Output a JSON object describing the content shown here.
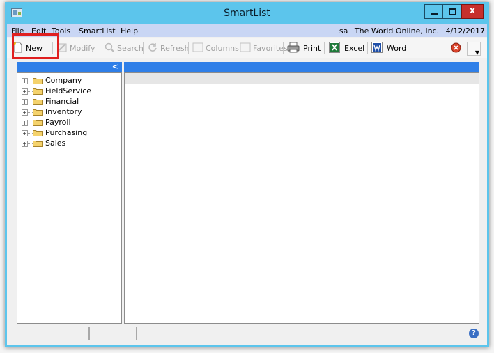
{
  "window": {
    "title": "SmartList"
  },
  "menu": {
    "file": "File",
    "edit": "Edit",
    "tools": "Tools",
    "smartlist": "SmartList",
    "help": "Help"
  },
  "company_info": {
    "user": "sa",
    "company": "The World Online, Inc.",
    "date": "4/12/2017"
  },
  "toolbar": {
    "new": "New",
    "modify": "Modify",
    "search": "Search",
    "refresh": "Refresh",
    "columns": "Columns",
    "favorites": "Favorites",
    "print": "Print",
    "excel": "Excel",
    "word": "Word"
  },
  "tree": {
    "collapse_glyph": "<",
    "nodes": [
      {
        "label": "Company"
      },
      {
        "label": "FieldService"
      },
      {
        "label": "Financial"
      },
      {
        "label": "Inventory"
      },
      {
        "label": "Payroll"
      },
      {
        "label": "Purchasing"
      },
      {
        "label": "Sales"
      }
    ]
  },
  "status": {
    "help_glyph": "?"
  }
}
